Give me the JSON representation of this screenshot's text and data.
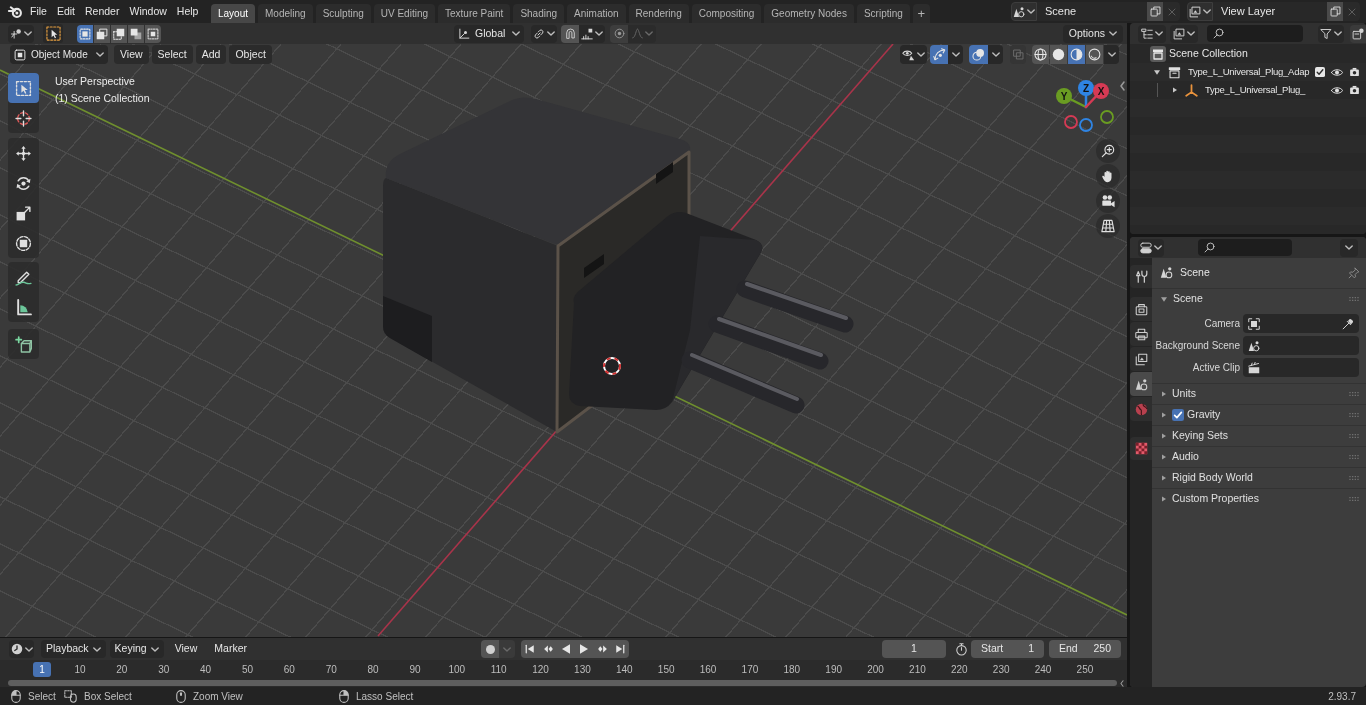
{
  "top_bar": {
    "menus": [
      "File",
      "Edit",
      "Render",
      "Window",
      "Help"
    ],
    "workspaces": [
      {
        "label": "Layout",
        "selected": true
      },
      {
        "label": "Modeling",
        "selected": false
      },
      {
        "label": "Sculpting",
        "selected": false
      },
      {
        "label": "UV Editing",
        "selected": false
      },
      {
        "label": "Texture Paint",
        "selected": false
      },
      {
        "label": "Shading",
        "selected": false
      },
      {
        "label": "Animation",
        "selected": false
      },
      {
        "label": "Rendering",
        "selected": false
      },
      {
        "label": "Compositing",
        "selected": false
      },
      {
        "label": "Geometry Nodes",
        "selected": false
      },
      {
        "label": "Scripting",
        "selected": false
      }
    ],
    "add_workspace": "+",
    "scene": "Scene",
    "view_layer": "View Layer"
  },
  "viewport": {
    "tool_header": {
      "select_modes": [
        {
          "selected": true
        },
        {
          "selected": false
        },
        {
          "selected": false
        },
        {
          "selected": false
        },
        {
          "selected": false
        }
      ],
      "orientation": "Global",
      "snap_on": false,
      "proportional_on": false,
      "options": "Options"
    },
    "header": {
      "mode": "Object Mode",
      "menus": [
        "View",
        "Select",
        "Add",
        "Object"
      ],
      "gizmos_on": true,
      "overlays_on": true,
      "xray_on": false,
      "shading_modes": [
        {
          "selected": false
        },
        {
          "selected": false
        },
        {
          "selected": true
        },
        {
          "selected": false
        }
      ]
    },
    "tools": [
      {
        "selected": true
      },
      {
        "selected": false
      },
      {
        "selected": false
      },
      {
        "selected": false
      },
      {
        "selected": false
      },
      {
        "selected": false
      },
      {
        "selected": false
      },
      {
        "selected": false
      },
      {
        "selected": false
      }
    ],
    "overlay_text": [
      "User Perspective",
      "(1) Scene Collection"
    ],
    "gizmo_axes": [
      {
        "label": "Y",
        "color": "#6a9c22"
      },
      {
        "label": "Z",
        "color": "#2f84e3"
      },
      {
        "label": "X",
        "color": "#d53a54"
      }
    ]
  },
  "outliner": {
    "root": "Scene Collection",
    "items": [
      {
        "label": "Type_L_Universal_Plug_Adap",
        "kind": "collection",
        "expanded": true,
        "checked": true,
        "children": [
          {
            "label": "Type_L_Universal_Plug_",
            "kind": "object",
            "expanded": false
          }
        ]
      }
    ]
  },
  "properties": {
    "tabs": [
      {
        "selected": false
      },
      {
        "selected": false
      },
      {
        "selected": false
      },
      {
        "selected": false
      },
      {
        "selected": true
      },
      {
        "selected": false
      },
      {
        "selected": false
      }
    ],
    "context": "Scene",
    "panels": [
      {
        "title": "Scene",
        "expanded": true,
        "fields": [
          "Camera",
          "Background Scene",
          "Active Clip"
        ]
      },
      {
        "title": "Units",
        "expanded": false
      },
      {
        "title": "Gravity",
        "expanded": false,
        "checked": true
      },
      {
        "title": "Keying Sets",
        "expanded": false
      },
      {
        "title": "Audio",
        "expanded": false
      },
      {
        "title": "Rigid Body World",
        "expanded": false
      },
      {
        "title": "Custom Properties",
        "expanded": false
      }
    ]
  },
  "timeline": {
    "menus": [
      {
        "label": "Playback",
        "kind": "dropdown"
      },
      {
        "label": "Keying",
        "kind": "dropdown"
      },
      {
        "label": "View",
        "kind": "menu"
      },
      {
        "label": "Marker",
        "kind": "menu"
      }
    ],
    "record_on": false,
    "current_frame": "1",
    "start_label": "Start",
    "start": "1",
    "end_label": "End",
    "end": "250",
    "ruler": [
      {
        "label": "1",
        "selected": true
      },
      {
        "label": "10",
        "selected": false
      },
      {
        "label": "20",
        "selected": false
      },
      {
        "label": "30",
        "selected": false
      },
      {
        "label": "40",
        "selected": false
      },
      {
        "label": "50",
        "selected": false
      },
      {
        "label": "60",
        "selected": false
      },
      {
        "label": "70",
        "selected": false
      },
      {
        "label": "80",
        "selected": false
      },
      {
        "label": "90",
        "selected": false
      },
      {
        "label": "100",
        "selected": false
      },
      {
        "label": "110",
        "selected": false
      },
      {
        "label": "120",
        "selected": false
      },
      {
        "label": "130",
        "selected": false
      },
      {
        "label": "140",
        "selected": false
      },
      {
        "label": "150",
        "selected": false
      },
      {
        "label": "160",
        "selected": false
      },
      {
        "label": "170",
        "selected": false
      },
      {
        "label": "180",
        "selected": false
      },
      {
        "label": "190",
        "selected": false
      },
      {
        "label": "200",
        "selected": false
      },
      {
        "label": "210",
        "selected": false
      },
      {
        "label": "220",
        "selected": false
      },
      {
        "label": "230",
        "selected": false
      },
      {
        "label": "240",
        "selected": false
      },
      {
        "label": "250",
        "selected": false
      }
    ]
  },
  "status_bar": {
    "hints": [
      "Select",
      "Box Select",
      "Zoom View",
      "Lasso Select"
    ],
    "version": "2.93.7"
  }
}
